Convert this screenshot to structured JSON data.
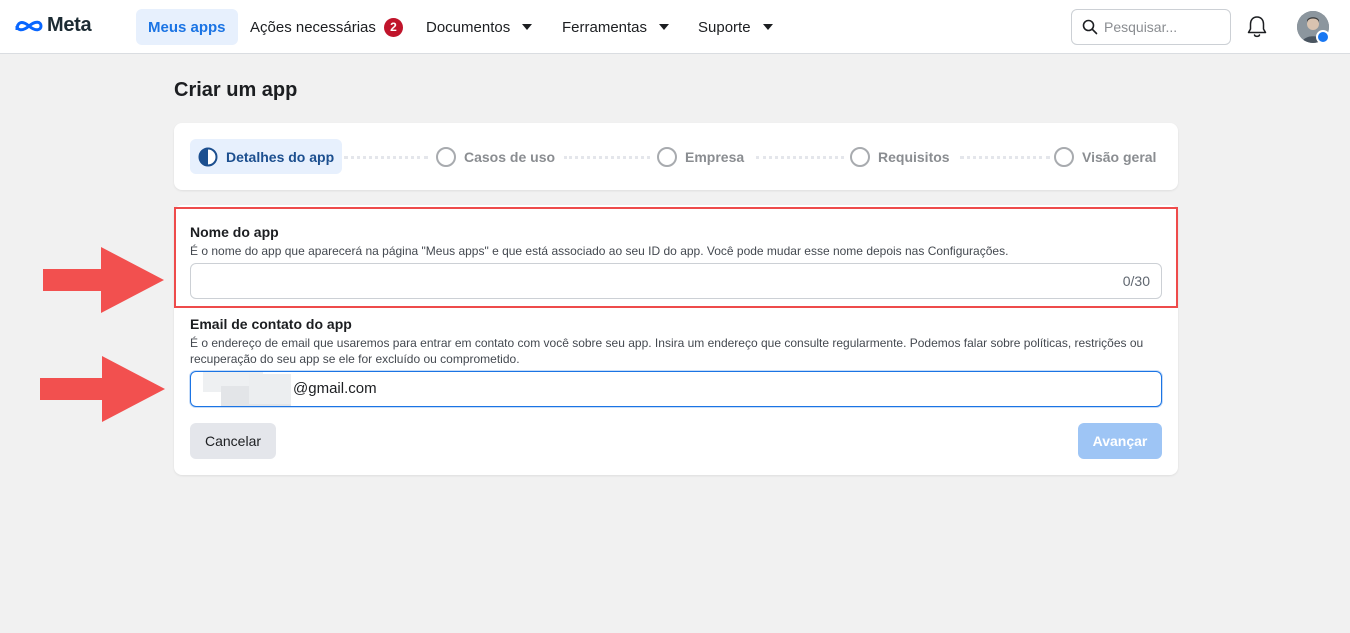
{
  "nav": {
    "brand": "Meta",
    "items": [
      {
        "label": "Meus apps"
      },
      {
        "label": "Ações necessárias",
        "badge": "2"
      },
      {
        "label": "Documentos"
      },
      {
        "label": "Ferramentas"
      },
      {
        "label": "Suporte"
      }
    ],
    "search_placeholder": "Pesquisar..."
  },
  "page": {
    "title": "Criar um app"
  },
  "steps": [
    {
      "label": "Detalhes do app",
      "state": "active"
    },
    {
      "label": "Casos de uso",
      "state": "pending"
    },
    {
      "label": "Empresa",
      "state": "pending"
    },
    {
      "label": "Requisitos",
      "state": "pending"
    },
    {
      "label": "Visão geral",
      "state": "pending"
    }
  ],
  "form": {
    "app_name": {
      "label": "Nome do app",
      "help": "É o nome do app que aparecerá na página \"Meus apps\" e que está associado ao seu ID do app. Você pode mudar esse nome depois nas Configurações.",
      "value": "",
      "counter": "0/30"
    },
    "contact_email": {
      "label": "Email de contato do app",
      "help": "É o endereço de email que usaremos para entrar em contato com você sobre seu app. Insira um endereço que consulte regularmente. Podemos falar sobre políticas, restrições ou recuperação do seu app se ele for excluído ou comprometido.",
      "value_suffix": "@gmail.com"
    },
    "cancel_label": "Cancelar",
    "next_label": "Avançar"
  },
  "colors": {
    "accent": "#1b74e4",
    "annotation_red": "#ee4b4b",
    "badge_red": "#c0142b"
  }
}
